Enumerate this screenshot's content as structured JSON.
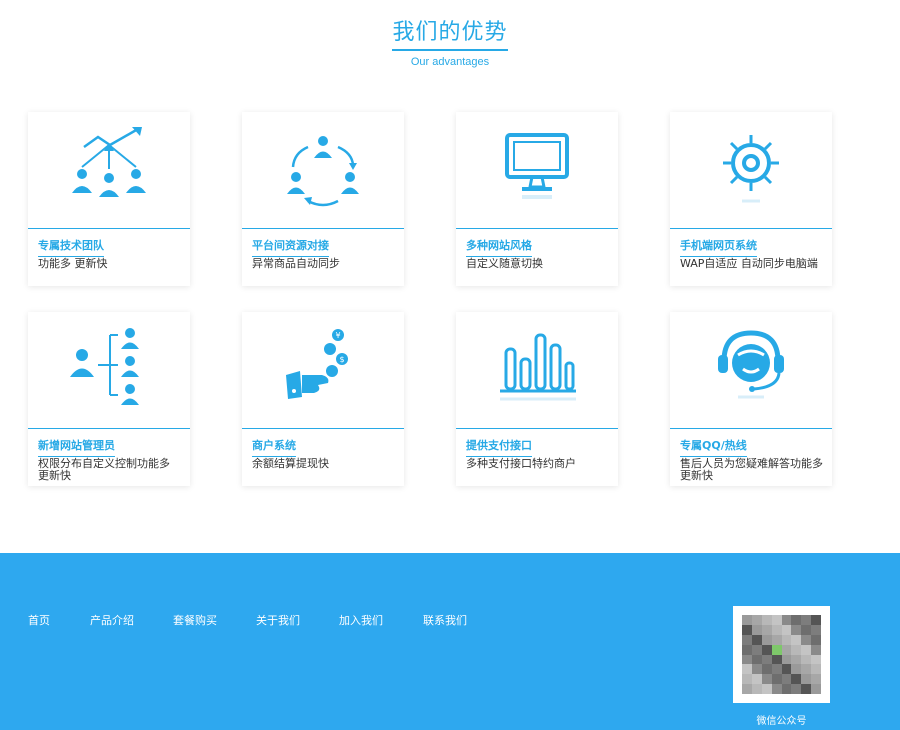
{
  "section": {
    "title": "我们的优势",
    "subtitle": "Our advantages"
  },
  "features": [
    {
      "title": "专属技术团队",
      "desc": "功能多 更新快",
      "icon": "team-growth-icon"
    },
    {
      "title": "平台间资源对接",
      "desc": "异常商品自动同步",
      "icon": "resource-cycle-icon"
    },
    {
      "title": "多种网站风格",
      "desc": "自定义随意切换",
      "icon": "monitor-icon"
    },
    {
      "title": "手机端网页系统",
      "desc": "WAP自适应 自动同步电脑端",
      "icon": "gear-icon"
    },
    {
      "title": "新增网站管理员",
      "desc": "权限分布自定义控制功能多 更新快",
      "icon": "admin-hierarchy-icon"
    },
    {
      "title": "商户系统",
      "desc": "余额结算提现快",
      "icon": "currency-hand-icon"
    },
    {
      "title": "提供支付接口",
      "desc": "多种支付接口特约商户",
      "icon": "bar-chart-icon"
    },
    {
      "title": "专属QQ/热线",
      "desc": "售后人员为您疑难解答功能多 更新快",
      "icon": "headset-support-icon"
    }
  ],
  "footer": {
    "nav": [
      "首页",
      "产品介绍",
      "套餐购买",
      "关于我们",
      "加入我们",
      "联系我们"
    ],
    "qr_label": "微信公众号"
  },
  "colors": {
    "accent": "#27a9e6",
    "footer_bg": "#2ea8ef"
  }
}
